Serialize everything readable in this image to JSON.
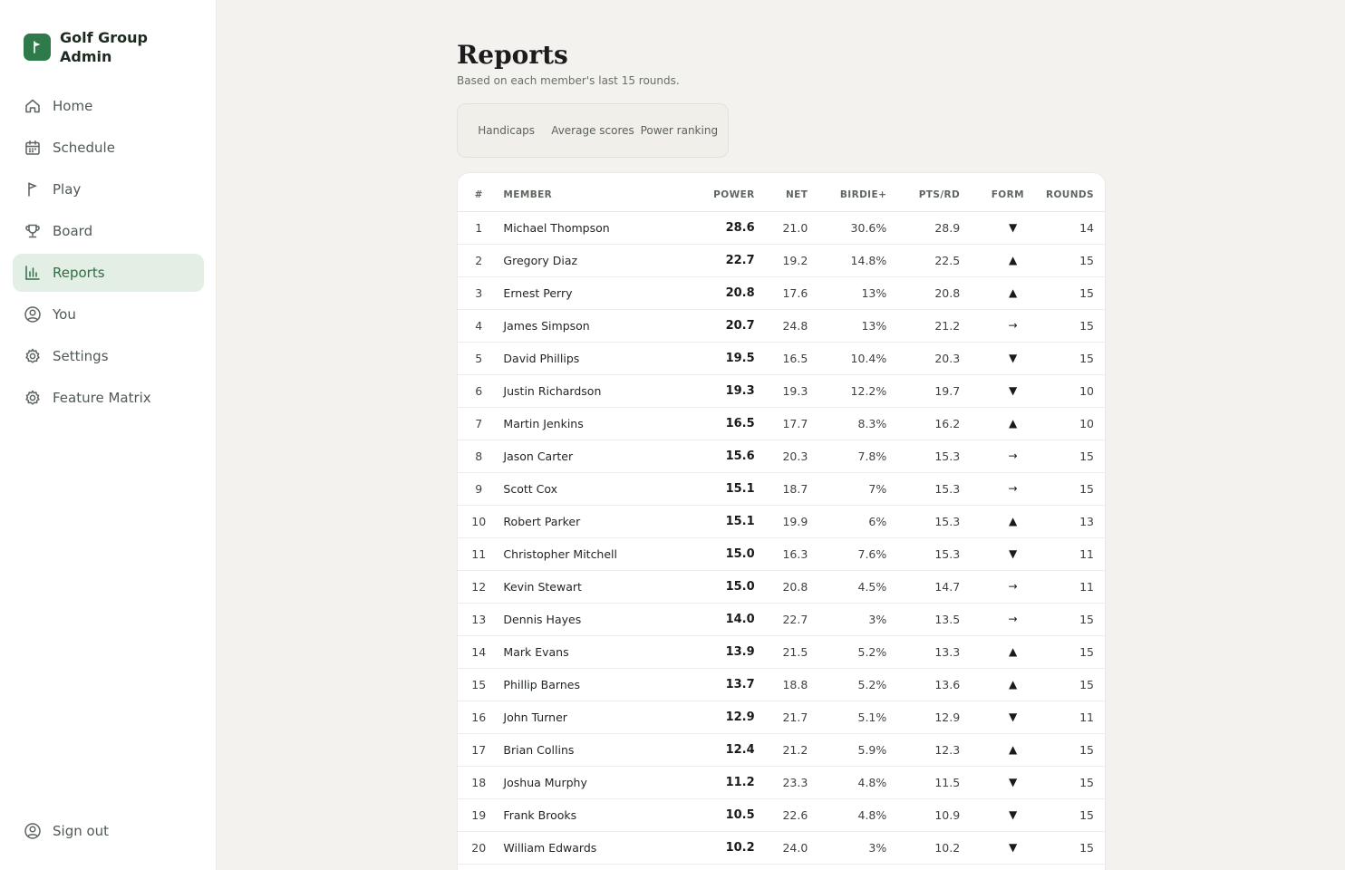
{
  "app": {
    "brand": "Golf Group Admin",
    "brand_color": "#2f7a4a",
    "accent_bg": "#e3efe5"
  },
  "sidebar": {
    "items": [
      {
        "label": "Home",
        "icon": "home-icon",
        "active": false
      },
      {
        "label": "Schedule",
        "icon": "calendar-icon",
        "active": false
      },
      {
        "label": "Play",
        "icon": "flag-icon",
        "active": false
      },
      {
        "label": "Board",
        "icon": "trophy-icon",
        "active": false
      },
      {
        "label": "Reports",
        "icon": "bar-chart-icon",
        "active": true
      },
      {
        "label": "You",
        "icon": "user-circle-icon",
        "active": false
      },
      {
        "label": "Settings",
        "icon": "gear-icon",
        "active": false
      },
      {
        "label": "Feature Matrix",
        "icon": "gear-icon",
        "active": false
      }
    ],
    "signout": "Sign out"
  },
  "page": {
    "title": "Reports",
    "subtitle": "Based on each member's last 15 rounds."
  },
  "tabs": [
    {
      "label": "Handicaps"
    },
    {
      "label": "Average scores"
    },
    {
      "label": "Power ranking"
    }
  ],
  "table": {
    "columns": [
      "#",
      "MEMBER",
      "POWER",
      "NET",
      "BIRDIE+",
      "PTS/RD",
      "FORM",
      "ROUNDS"
    ],
    "rows": [
      {
        "rank": "1",
        "member": "Michael Thompson",
        "power": "28.6",
        "net": "21.0",
        "birdie": "30.6%",
        "pts": "28.9",
        "form": "down",
        "rounds": "14"
      },
      {
        "rank": "2",
        "member": "Gregory Diaz",
        "power": "22.7",
        "net": "19.2",
        "birdie": "14.8%",
        "pts": "22.5",
        "form": "up",
        "rounds": "15"
      },
      {
        "rank": "3",
        "member": "Ernest Perry",
        "power": "20.8",
        "net": "17.6",
        "birdie": "13%",
        "pts": "20.8",
        "form": "up",
        "rounds": "15"
      },
      {
        "rank": "4",
        "member": "James Simpson",
        "power": "20.7",
        "net": "24.8",
        "birdie": "13%",
        "pts": "21.2",
        "form": "flat",
        "rounds": "15"
      },
      {
        "rank": "5",
        "member": "David Phillips",
        "power": "19.5",
        "net": "16.5",
        "birdie": "10.4%",
        "pts": "20.3",
        "form": "down",
        "rounds": "15"
      },
      {
        "rank": "6",
        "member": "Justin Richardson",
        "power": "19.3",
        "net": "19.3",
        "birdie": "12.2%",
        "pts": "19.7",
        "form": "down",
        "rounds": "10"
      },
      {
        "rank": "7",
        "member": "Martin Jenkins",
        "power": "16.5",
        "net": "17.7",
        "birdie": "8.3%",
        "pts": "16.2",
        "form": "up",
        "rounds": "10"
      },
      {
        "rank": "8",
        "member": "Jason Carter",
        "power": "15.6",
        "net": "20.3",
        "birdie": "7.8%",
        "pts": "15.3",
        "form": "flat",
        "rounds": "15"
      },
      {
        "rank": "9",
        "member": "Scott Cox",
        "power": "15.1",
        "net": "18.7",
        "birdie": "7%",
        "pts": "15.3",
        "form": "flat",
        "rounds": "15"
      },
      {
        "rank": "10",
        "member": "Robert Parker",
        "power": "15.1",
        "net": "19.9",
        "birdie": "6%",
        "pts": "15.3",
        "form": "up",
        "rounds": "13"
      },
      {
        "rank": "11",
        "member": "Christopher Mitchell",
        "power": "15.0",
        "net": "16.3",
        "birdie": "7.6%",
        "pts": "15.3",
        "form": "down",
        "rounds": "11"
      },
      {
        "rank": "12",
        "member": "Kevin Stewart",
        "power": "15.0",
        "net": "20.8",
        "birdie": "4.5%",
        "pts": "14.7",
        "form": "flat",
        "rounds": "11"
      },
      {
        "rank": "13",
        "member": "Dennis Hayes",
        "power": "14.0",
        "net": "22.7",
        "birdie": "3%",
        "pts": "13.5",
        "form": "flat",
        "rounds": "15"
      },
      {
        "rank": "14",
        "member": "Mark Evans",
        "power": "13.9",
        "net": "21.5",
        "birdie": "5.2%",
        "pts": "13.3",
        "form": "up",
        "rounds": "15"
      },
      {
        "rank": "15",
        "member": "Phillip Barnes",
        "power": "13.7",
        "net": "18.8",
        "birdie": "5.2%",
        "pts": "13.6",
        "form": "up",
        "rounds": "15"
      },
      {
        "rank": "16",
        "member": "John Turner",
        "power": "12.9",
        "net": "21.7",
        "birdie": "5.1%",
        "pts": "12.9",
        "form": "down",
        "rounds": "11"
      },
      {
        "rank": "17",
        "member": "Brian Collins",
        "power": "12.4",
        "net": "21.2",
        "birdie": "5.9%",
        "pts": "12.3",
        "form": "up",
        "rounds": "15"
      },
      {
        "rank": "18",
        "member": "Joshua Murphy",
        "power": "11.2",
        "net": "23.3",
        "birdie": "4.8%",
        "pts": "11.5",
        "form": "down",
        "rounds": "15"
      },
      {
        "rank": "19",
        "member": "Frank Brooks",
        "power": "10.5",
        "net": "22.6",
        "birdie": "4.8%",
        "pts": "10.9",
        "form": "down",
        "rounds": "15"
      },
      {
        "rank": "20",
        "member": "William Edwards",
        "power": "10.2",
        "net": "24.0",
        "birdie": "3%",
        "pts": "10.2",
        "form": "down",
        "rounds": "15"
      }
    ]
  }
}
